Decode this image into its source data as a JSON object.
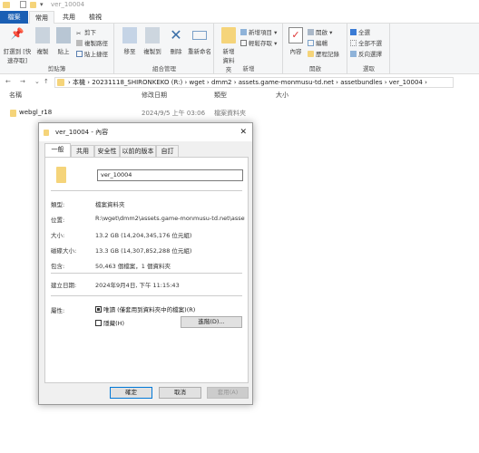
{
  "window": {
    "title": "ver_10004"
  },
  "ribbon_tabs": [
    "檔案",
    "常用",
    "共用",
    "檢視"
  ],
  "ribbon": {
    "clipboard": {
      "pin": "釘選到 [快速存取]",
      "copy": "複製",
      "paste": "貼上",
      "cut": "剪下",
      "copy_path": "複製路徑",
      "paste_shortcut": "貼上捷徑",
      "label": "剪貼簿"
    },
    "organize": {
      "move_to": "移至",
      "copy_to": "複製到",
      "delete": "刪除",
      "rename": "重新命名",
      "label": "組合管理"
    },
    "new": {
      "new_folder": "新增資料夾",
      "new_item": "新增項目",
      "easy_access": "輕鬆存取",
      "label": "新增"
    },
    "open": {
      "properties": "內容",
      "open": "開啟",
      "edit": "編輯",
      "history": "歷程記錄",
      "label": "開啟"
    },
    "select": {
      "select_all": "全選",
      "select_none": "全部不選",
      "invert": "反向選擇",
      "label": "選取"
    }
  },
  "address": {
    "crumbs": [
      "本機",
      "20231118_SHIRONKEKO (R:)",
      "wget",
      "dmm2",
      "assets.game-monmusu-td.net",
      "assetbundles",
      "ver_10004"
    ]
  },
  "columns": [
    "名稱",
    "修改日期",
    "類型",
    "大小"
  ],
  "files": [
    {
      "name": "webgl_r18",
      "modified": "2024/9/5 上午 03:06",
      "type": "檔案資料夾",
      "size": ""
    }
  ],
  "dialog": {
    "title": "ver_10004 - 內容",
    "tabs": [
      "一般",
      "共用",
      "安全性",
      "以前的版本",
      "自訂"
    ],
    "name_value": "ver_10004",
    "rows": [
      {
        "label": "類型:",
        "value": "檔案資料夾"
      },
      {
        "label": "位置:",
        "value": "R:\\wget\\dmm2\\assets.game-monmusu-td.net\\assetbundles"
      },
      {
        "label": "大小:",
        "value": "13.2 GB (14,204,345,176 位元組)"
      },
      {
        "label": "磁碟大小:",
        "value": "13.3 GB (14,307,852,288 位元組)"
      },
      {
        "label": "包含:",
        "value": "50,463 個檔案，1 個資料夾"
      }
    ],
    "created_label": "建立日期:",
    "created_value": "2024年9月4日, 下午 11:15:43",
    "attr_label": "屬性:",
    "readonly": "唯讀 (僅套用到資料夾中的檔案)(R)",
    "hidden": "隱藏(H)",
    "advanced": "進階(D)...",
    "ok": "確定",
    "cancel": "取消",
    "apply": "套用(A)"
  }
}
